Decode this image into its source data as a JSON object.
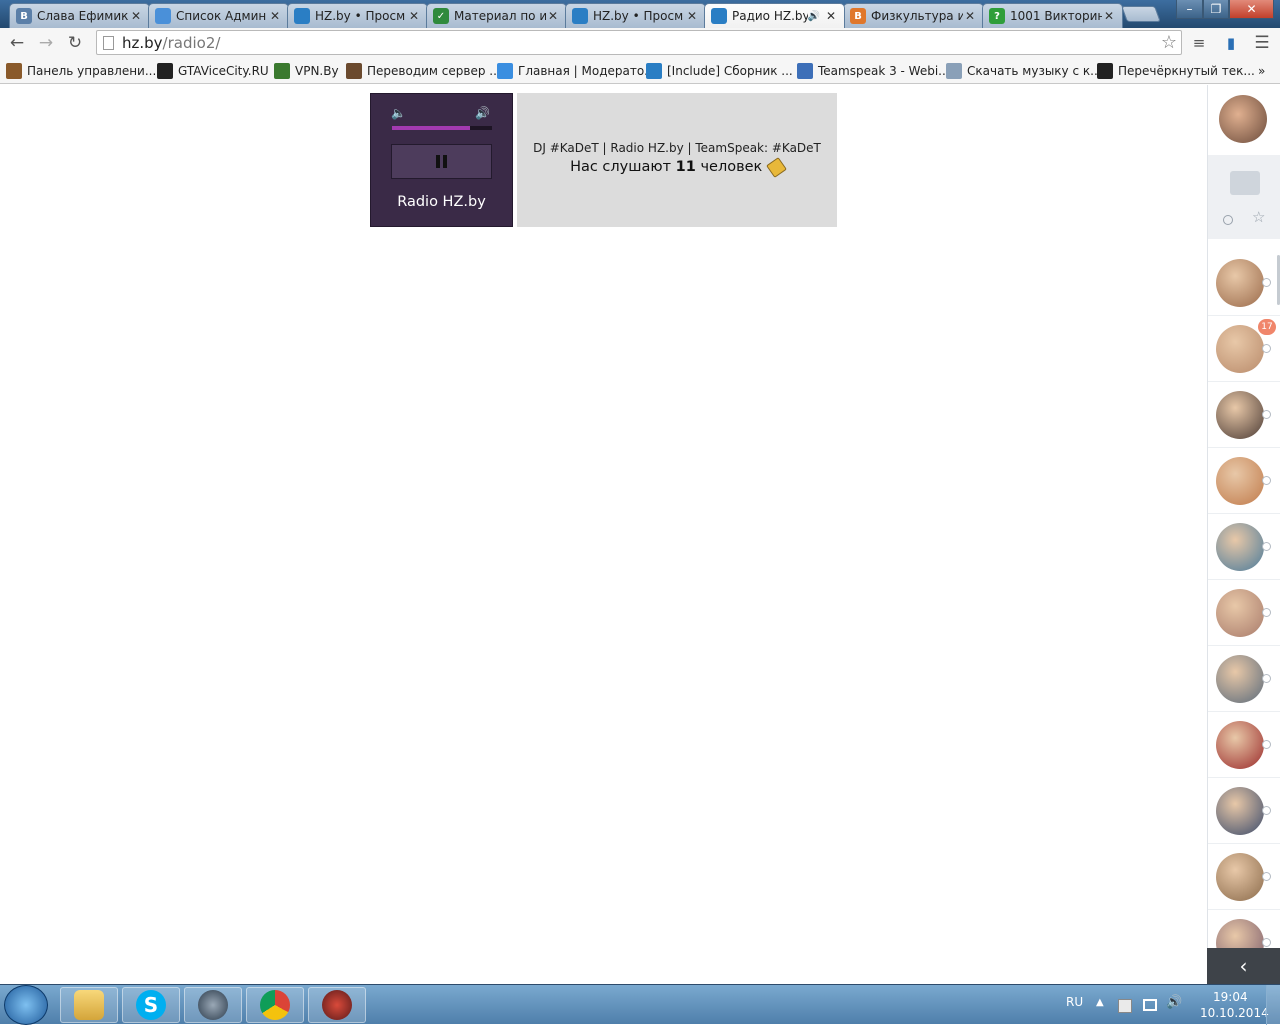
{
  "browser": {
    "tabs": [
      {
        "label": "Слава Ефимик",
        "favicon_text": "В",
        "favicon_color": "#5b7fa8"
      },
      {
        "label": "Список Админ",
        "favicon_text": "",
        "favicon_color": "#4a90d9"
      },
      {
        "label": "HZ.by • Просм",
        "favicon_text": "",
        "favicon_color": "#2a7ec4"
      },
      {
        "label": "Материал по и",
        "favicon_text": "✓",
        "favicon_color": "#2f8a3c"
      },
      {
        "label": "HZ.by • Просм",
        "favicon_text": "",
        "favicon_color": "#2a7ec4"
      },
      {
        "label": "Радио HZ.by",
        "favicon_text": "",
        "favicon_color": "#2a7ec4",
        "active": true
      },
      {
        "label": "Физкультура и",
        "favicon_text": "B",
        "favicon_color": "#e0772b"
      },
      {
        "label": "1001 Викторина",
        "favicon_text": "?",
        "favicon_color": "#2f9e3a"
      }
    ],
    "url_host": "hz.by",
    "url_path": "/radio2/",
    "bookmarks": [
      {
        "label": "Панель управлени...",
        "icon": "control-panel-icon",
        "color": "#8a5a2b"
      },
      {
        "label": "GTAViceCity.RU",
        "icon": "gun-icon",
        "color": "#222222"
      },
      {
        "label": "VPN.By",
        "icon": "search-key-icon",
        "color": "#3b7a2f"
      },
      {
        "label": "Переводим сервер ...",
        "icon": "person-icon",
        "color": "#6b4a2e"
      },
      {
        "label": "Главная | Модерато...",
        "icon": "chat-icon",
        "color": "#3a8ee0"
      },
      {
        "label": "[Include] Сборник ...",
        "icon": "st-icon",
        "color": "#2a7ec4"
      },
      {
        "label": "Teamspeak 3 - Webi...",
        "icon": "globe-icon",
        "color": "#3d6fb8"
      },
      {
        "label": "Скачать музыку с к...",
        "icon": "download-icon",
        "color": "#8aa0b8"
      },
      {
        "label": "Перечёркнутый тек...",
        "icon": "sx-icon",
        "color": "#222222"
      }
    ]
  },
  "player": {
    "station": "Radio HZ.by",
    "volume": 0.78,
    "accent": "#a23ab0"
  },
  "info": {
    "dj_line": "DJ #KaDeT | Radio HZ.by | TeamSpeak: #KaDeT",
    "listeners_prefix": "Нас слушают",
    "listeners_count": "11",
    "listeners_suffix": "человек"
  },
  "sidebar": {
    "badge_count": "17",
    "contacts": [
      {
        "color": "#9a6a4a"
      },
      {
        "color": "#b88a6a",
        "badge": true
      },
      {
        "color": "#4a3a34"
      },
      {
        "color": "#c07a4a"
      },
      {
        "color": "#4a7a9a"
      },
      {
        "color": "#a87a6a"
      },
      {
        "color": "#5a6a7a"
      },
      {
        "color": "#9a2a2a"
      },
      {
        "color": "#3a4a6a"
      },
      {
        "color": "#8a6a4a"
      },
      {
        "color": "#7a5a6a"
      }
    ]
  },
  "taskbar": {
    "lang": "RU",
    "time": "19:04",
    "date": "10.10.2014"
  }
}
